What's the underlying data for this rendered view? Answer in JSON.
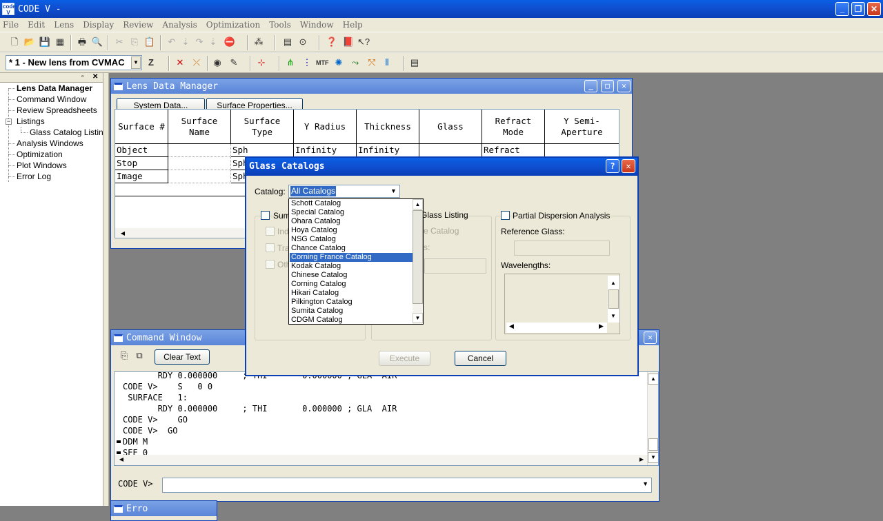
{
  "app": {
    "title": "CODE V -",
    "icon_text": "code V"
  },
  "menu": [
    "File",
    "Edit",
    "Lens",
    "Display",
    "Review",
    "Analysis",
    "Optimization",
    "Tools",
    "Window",
    "Help"
  ],
  "toolbar": {
    "lens_selector": "* 1 - New lens from CVMAC",
    "z_label": "Z"
  },
  "tree": {
    "items": [
      "Lens Data Manager",
      "Command Window",
      "Review Spreadsheets",
      "Listings",
      "Glass Catalog Listing",
      "Analysis Windows",
      "Optimization",
      "Plot Windows",
      "Error Log"
    ]
  },
  "ldm": {
    "title": "Lens Data Manager",
    "system_data_btn": "System Data...",
    "surface_props_btn": "Surface Properties...",
    "columns": [
      "Surface #",
      "Surface Name",
      "Surface Type",
      "Y Radius",
      "Thickness",
      "Glass",
      "Refract Mode",
      "Y Semi-Aperture"
    ],
    "rows": [
      {
        "surface": "Object",
        "type": "Sph",
        "radius": "Infinity",
        "thickness": "Infinity",
        "mode": "Refract"
      },
      {
        "surface": "Stop",
        "type": "Sph"
      },
      {
        "surface": "Image",
        "type": "Sph"
      }
    ]
  },
  "cmd": {
    "title": "Command Window",
    "clear_btn": "Clear Text",
    "lines": [
      "       RDY 0.000000     ; THI       0.000000 ; GLA  AIR",
      "CODE V>    S   0 0",
      " SURFACE   1:",
      "       RDY 0.000000     ; THI       0.000000 ; GLA  AIR",
      "CODE V>    GO",
      "CODE V>  GO",
      "DDM M",
      "SEE 0"
    ],
    "prompt": "CODE V>"
  },
  "dialog": {
    "title": "Glass Catalogs",
    "help_btn": "?",
    "catalog_label": "Catalog:",
    "catalog_value": "All Catalogs",
    "catalog_options": [
      "Schott Catalog",
      "Special Catalog",
      "Ohara Catalog",
      "Hoya Catalog",
      "NSG Catalog",
      "Chance Catalog",
      "Corning France Catalog",
      "Kodak Catalog",
      "Chinese Catalog",
      "Corning Catalog",
      "Hikari Catalog",
      "Pilkington Catalog",
      "Sumita Catalog",
      "CDGM Catalog"
    ],
    "selected_index": 6,
    "summary_label": "Sum",
    "index_label": "Ind",
    "transmission_label": "Tra",
    "other_label": "Oth",
    "glass_listing_label": "Glass Listing",
    "single_catalog_label": "e Catalog",
    "partial_label": "Partial Dispersion Analysis",
    "reference_label": "Reference Glass:",
    "wavelengths_label": "Wavelengths:",
    "execute_btn": "Execute",
    "cancel_btn": "Cancel"
  },
  "error_window": {
    "title": "Erro"
  }
}
